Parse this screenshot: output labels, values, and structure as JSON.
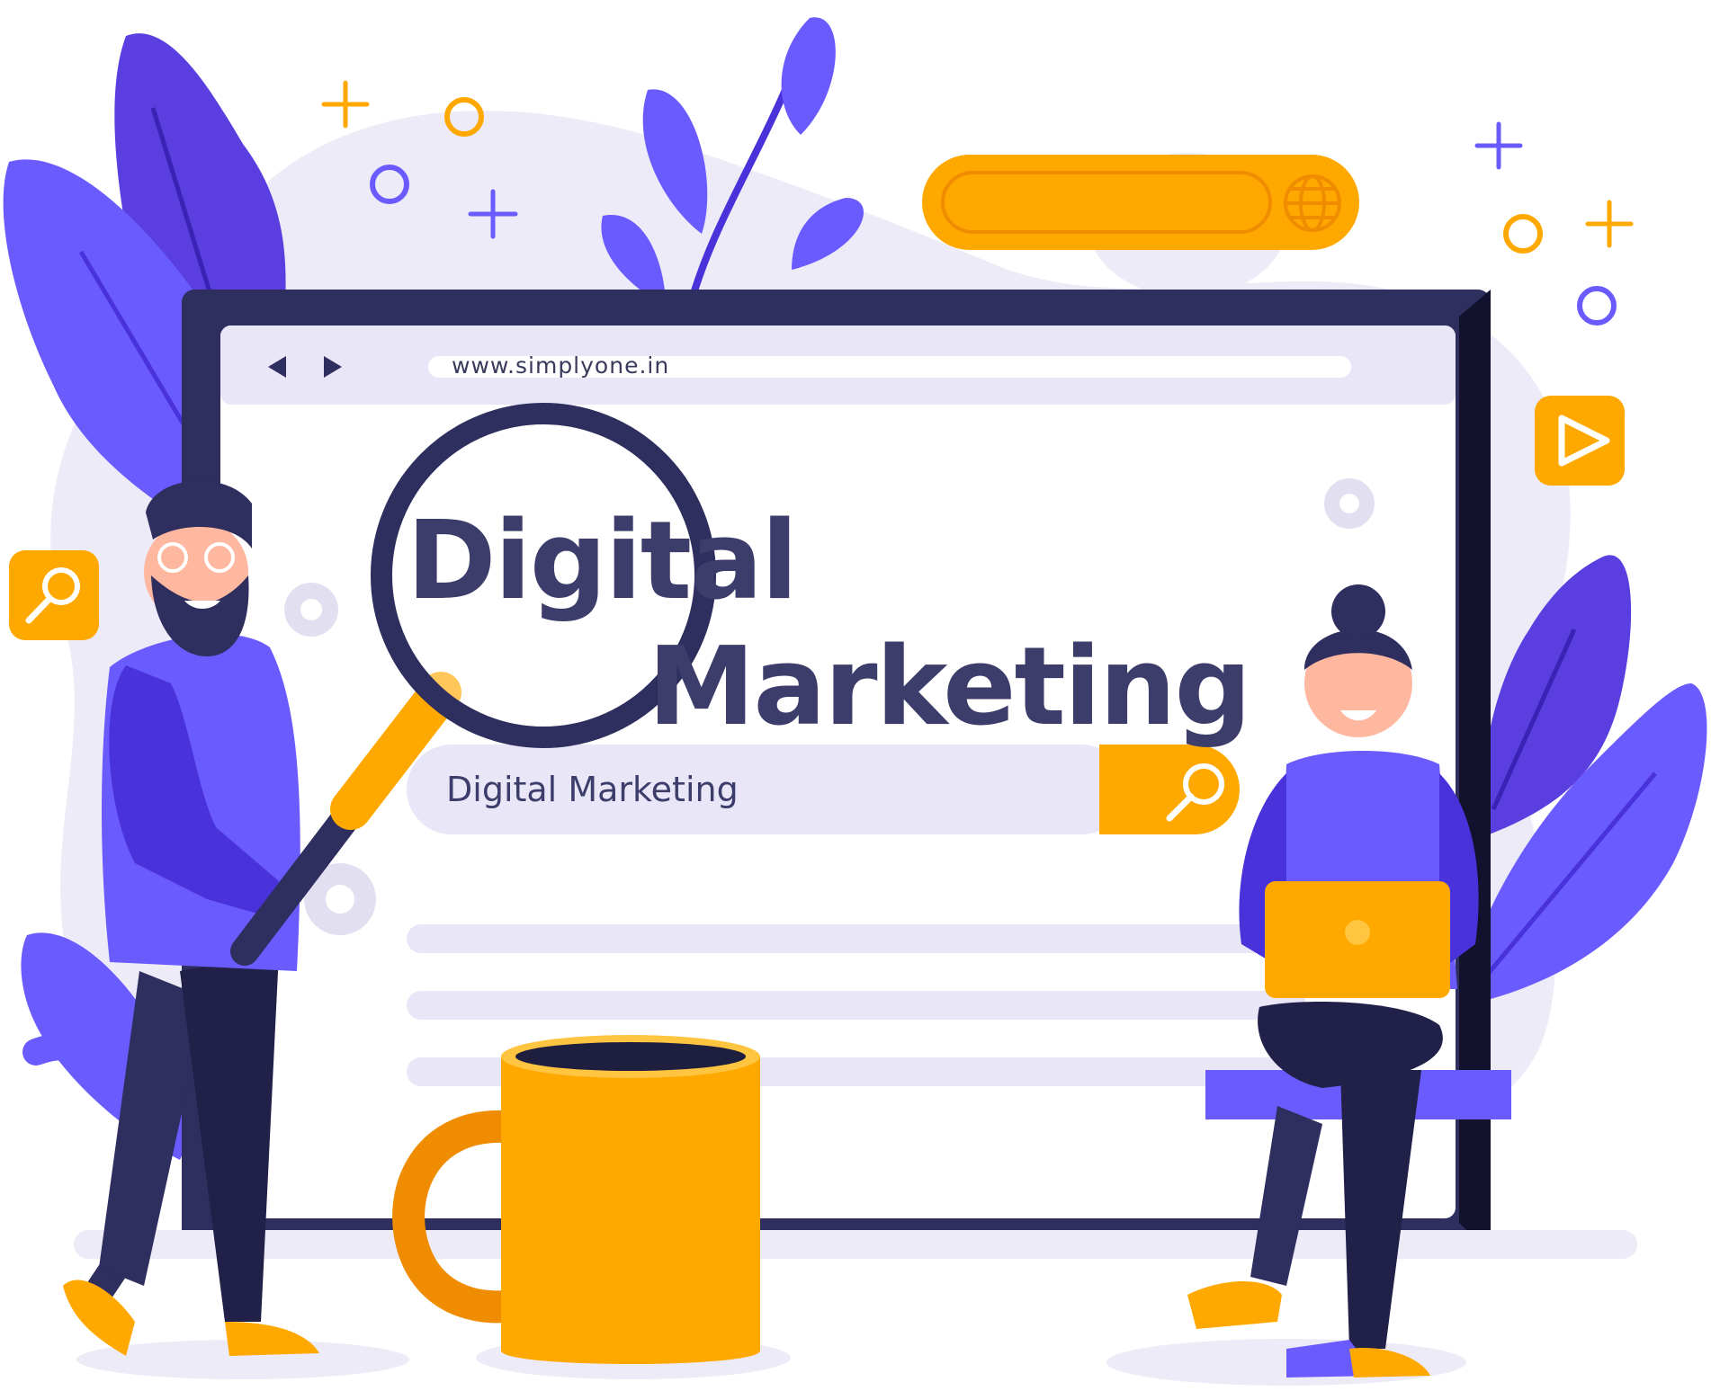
{
  "browser": {
    "address_bar": "www.simplyone.in"
  },
  "hero": {
    "line1": "Digital",
    "line2": "Marketing"
  },
  "search": {
    "query": "Digital Marketing"
  },
  "icons": {
    "back": "triangle-left-icon",
    "forward": "triangle-right-icon",
    "search": "magnifier-icon",
    "globe": "globe-icon",
    "play": "play-icon",
    "gear": "gear-icon"
  },
  "colors": {
    "accent_yellow": "#FFA800",
    "purple": "#6A5BFF",
    "dark_purple": "#4A32DB",
    "navy": "#2E2E5F",
    "background_blob": "#EDEBF8"
  }
}
